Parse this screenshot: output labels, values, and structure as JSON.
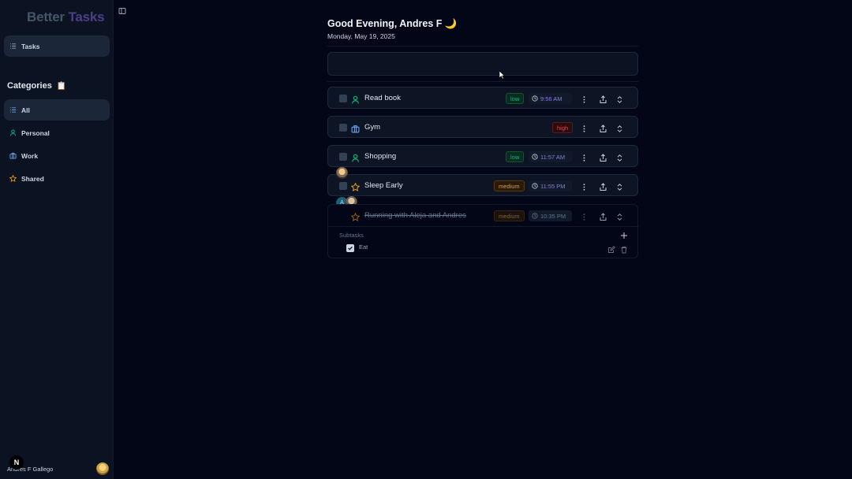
{
  "app": {
    "brand_part1": "Better",
    "brand_part2": "Tasks"
  },
  "sidebar": {
    "nav": [
      {
        "label": "Tasks",
        "icon": "list-icon"
      }
    ],
    "categories_title": "Categories",
    "categories_emoji": "📋",
    "categories": [
      {
        "label": "All",
        "icon": "list-icon"
      },
      {
        "label": "Personal",
        "icon": "user-icon"
      },
      {
        "label": "Work",
        "icon": "briefcase-icon"
      },
      {
        "label": "Shared",
        "icon": "star-icon"
      }
    ],
    "user_name": "Andres F Gallego",
    "badge_letter": "N"
  },
  "header": {
    "greeting": "Good Evening, Andres F 🌙",
    "date": "Monday, May 19, 2025"
  },
  "tasks": [
    {
      "title": "Read book",
      "category_icon": "user-icon",
      "priority": "low",
      "time": "9:56 AM",
      "done": false
    },
    {
      "title": "Gym",
      "category_icon": "briefcase-icon",
      "priority": "high",
      "time": "",
      "done": false
    },
    {
      "title": "Shopping",
      "category_icon": "user-icon",
      "priority": "low",
      "time": "11:57 AM",
      "done": false
    },
    {
      "title": "Sleep Early",
      "category_icon": "star-icon",
      "priority": "medium",
      "time": "11:55 PM",
      "done": false
    },
    {
      "title": "Running with Aleja and Andres",
      "category_icon": "star-icon",
      "priority": "medium",
      "time": "10:35 PM",
      "done": true
    }
  ],
  "subtasks": {
    "label": "Subtasks",
    "items": [
      {
        "title": "Eat",
        "done": true
      }
    ]
  },
  "avatar_initial": "A",
  "colors": {
    "accent": "#8b7bd8",
    "low": "#10b981",
    "high": "#ef4444",
    "medium": "#f59e0b"
  }
}
